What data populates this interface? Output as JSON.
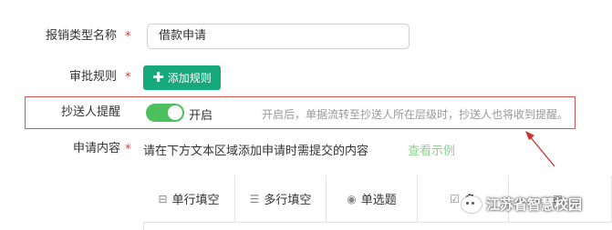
{
  "form": {
    "expense_type": {
      "label": "报销类型名称",
      "required_mark": "*",
      "value": "借款申请"
    },
    "approval_rule": {
      "label": "审批规则",
      "required_mark": "*",
      "button_label": "添加规则"
    },
    "cc_reminder": {
      "label": "抄送人提醒",
      "toggle_state": "on",
      "toggle_text": "开启",
      "hint": "开启后，单据流转至抄送人所在层级时，抄送人也将收到提醒。"
    },
    "request_content": {
      "label": "申请内容",
      "required_mark": "*",
      "description": "请在下方文本区域添加申请时需提交的内容",
      "example_link": "查看示例"
    }
  },
  "toolbar": {
    "items": [
      {
        "label": "单行填空",
        "icon": "single-line-icon"
      },
      {
        "label": "多行填空",
        "icon": "multi-line-icon"
      },
      {
        "label": "单选题",
        "icon": "radio-icon"
      },
      {
        "label": "多",
        "icon": "checkbox-icon"
      },
      {
        "label": "",
        "icon": "date-icon"
      }
    ]
  },
  "watermark": {
    "text": "江苏省智慧校园",
    "icon": "wechat-icon"
  },
  "colors": {
    "primary": "#16a97a",
    "toggle_on": "#4cc05e",
    "required": "#e03c3c",
    "highlight_border": "#d9534f",
    "link": "#8ed08f",
    "hint": "#999999",
    "annotation_arrow": "#c9302c"
  }
}
